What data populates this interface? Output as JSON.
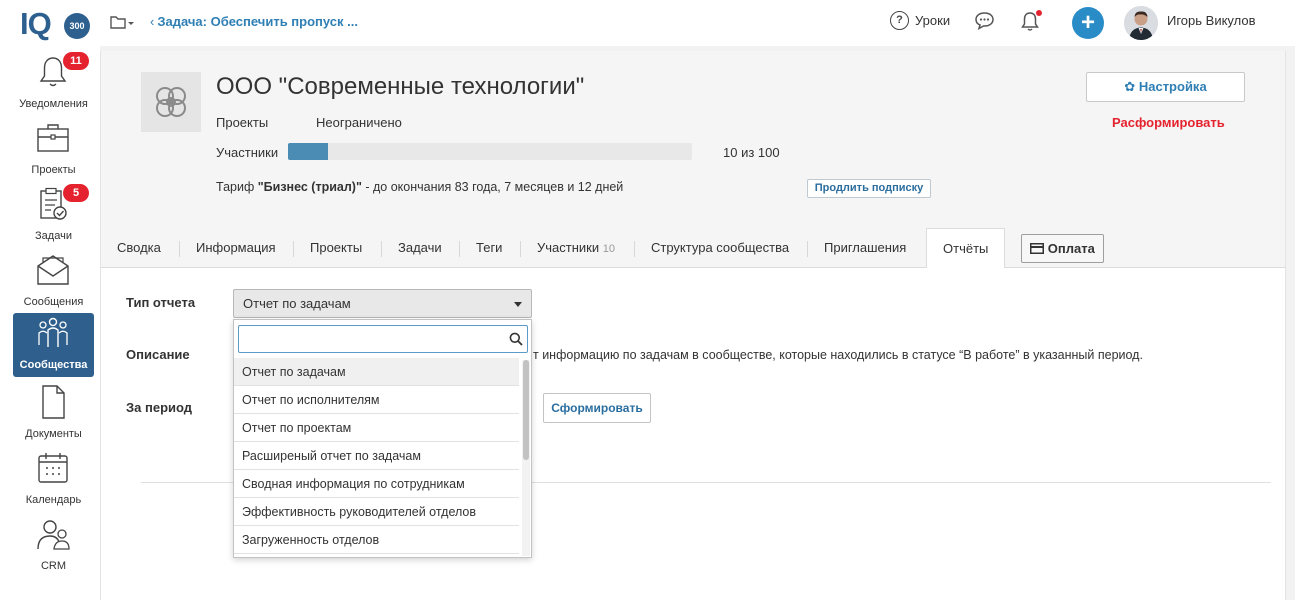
{
  "app": {
    "logo_text": "IQ",
    "logo_badge": "300"
  },
  "header": {
    "breadcrumb": "Задача: Обеспечить пропуск ...",
    "lessons_label": "Уроки",
    "help_icon_char": "?",
    "plus_char": "+",
    "user_name": "Игорь Викулов",
    "accent_color": "#2a8cc7"
  },
  "sidebar": {
    "items": [
      {
        "label": "Уведомления",
        "icon": "bell-icon",
        "badge": "11"
      },
      {
        "label": "Проекты",
        "icon": "briefcase-icon"
      },
      {
        "label": "Задачи",
        "icon": "tasks-clipboard-icon",
        "badge": "5"
      },
      {
        "label": "Сообщения",
        "icon": "envelope-icon"
      },
      {
        "label": "Сообщества",
        "icon": "community-people-icon",
        "active": true
      },
      {
        "label": "Документы",
        "icon": "document-icon"
      },
      {
        "label": "Календарь",
        "icon": "calendar-icon"
      },
      {
        "label": "CRM",
        "icon": "crm-people-icon"
      }
    ]
  },
  "org": {
    "title": "ООО \"Современные технологии\"",
    "projects_label": "Проекты",
    "projects_value": "Неограничено",
    "members_label": "Участники",
    "members_value": "10 из 100",
    "members_fraction": 0.1,
    "tariff_prefix": "Тариф ",
    "tariff_name": "\"Бизнес (триал)\"",
    "tariff_suffix": " - до окончания 83 года, 7 месяцев и 12 дней",
    "extend_label": "Продлить подписку",
    "settings_label": "Настройка",
    "dissolve_label": "Расформировать"
  },
  "tabs": [
    {
      "label": "Сводка"
    },
    {
      "label": "Информация"
    },
    {
      "label": "Проекты"
    },
    {
      "label": "Задачи"
    },
    {
      "label": "Теги"
    },
    {
      "label": "Участники",
      "count": "10"
    },
    {
      "label": "Структура сообщества"
    },
    {
      "label": "Приглашения"
    },
    {
      "label": "Отчёты",
      "active": true
    }
  ],
  "pay_label": "Оплата",
  "report": {
    "type_label": "Тип отчета",
    "selected": "Отчет по задачам",
    "description_label": "Описание",
    "description_lead": "",
    "description_text": "т информацию по задачам в сообществе, которые находились в статусе “В работе” в указанный период.",
    "period_label": "За период",
    "generate_label": "Сформировать"
  },
  "dropdown": {
    "search_value": "",
    "options": [
      "Отчет по задачам",
      "Отчет по исполнителям",
      "Отчет по проектам",
      "Расширеный отчет по задачам",
      "Сводная информация по сотрудникам",
      "Эффективность руководителей отделов",
      "Загруженность отделов"
    ]
  }
}
